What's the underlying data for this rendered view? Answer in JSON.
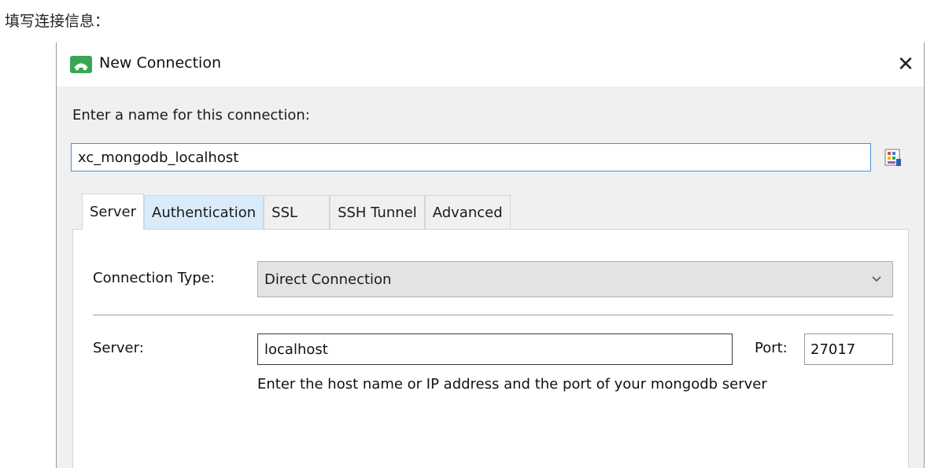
{
  "caption": "填写连接信息：",
  "dialog": {
    "title": "New Connection",
    "close_glyph": "✕",
    "name_label": "Enter a name for this connection:",
    "name_value": "xc_mongodb_localhost"
  },
  "tabs": [
    {
      "label": "Server",
      "active": true
    },
    {
      "label": "Authentication",
      "active": false
    },
    {
      "label": "SSL",
      "active": false
    },
    {
      "label": "SSH Tunnel",
      "active": false
    },
    {
      "label": "Advanced",
      "active": false
    }
  ],
  "server_tab": {
    "connection_type_label": "Connection Type:",
    "connection_type_value": "Direct Connection",
    "server_label": "Server:",
    "server_value": "localhost",
    "port_label": "Port:",
    "port_value": "27017",
    "hint": "Enter the host name or IP address and the port of your mongodb server"
  },
  "colors": {
    "accent": "#4a90d9",
    "app_icon": "#3aa655",
    "tab_hover": "#d9ebf9"
  },
  "icons": {
    "app": "robo3t-app-icon",
    "close": "close-icon",
    "picker": "color-picker-icon",
    "dropdown": "chevron-down-icon"
  }
}
